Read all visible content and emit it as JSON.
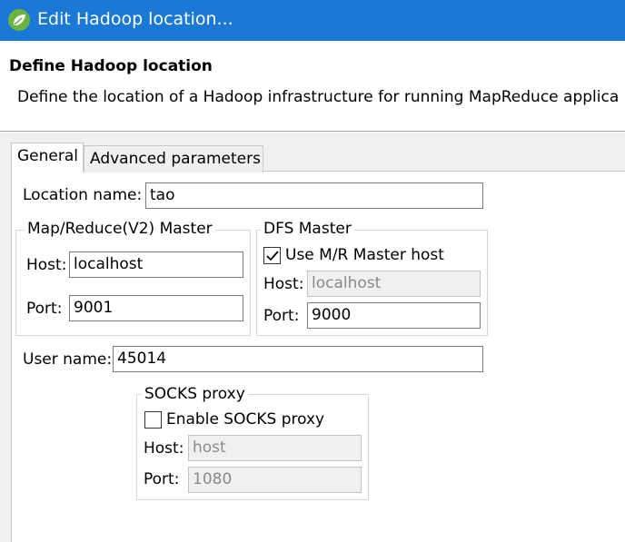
{
  "window": {
    "title": "Edit Hadoop location..."
  },
  "header": {
    "title": "Define Hadoop location",
    "description": "Define the location of a Hadoop infrastructure for running MapReduce applica"
  },
  "tabs": [
    {
      "label": "General",
      "selected": true
    },
    {
      "label": "Advanced parameters",
      "selected": false
    }
  ],
  "general": {
    "location_name_label": "Location name:",
    "location_name_value": "tao",
    "mr_master": {
      "title": "Map/Reduce(V2) Master",
      "host_label": "Host:",
      "host_value": "localhost",
      "port_label": "Port:",
      "port_value": "9001"
    },
    "dfs_master": {
      "title": "DFS Master",
      "use_mr_host_label": "Use M/R Master host",
      "use_mr_host_checked": true,
      "host_label": "Host:",
      "host_value": "localhost",
      "port_label": "Port:",
      "port_value": "9000"
    },
    "user_name_label": "User name:",
    "user_name_value": "45014",
    "socks_proxy": {
      "title": "SOCKS proxy",
      "enable_label": "Enable SOCKS proxy",
      "enable_checked": false,
      "host_label": "Host:",
      "host_value": "host",
      "port_label": "Port:",
      "port_value": "1080"
    }
  },
  "icons": {
    "app": "spring-leaf-icon",
    "check": "checkmark-icon"
  },
  "colors": {
    "titlebar": "#1a78d6",
    "app_icon": "#6db33f"
  }
}
